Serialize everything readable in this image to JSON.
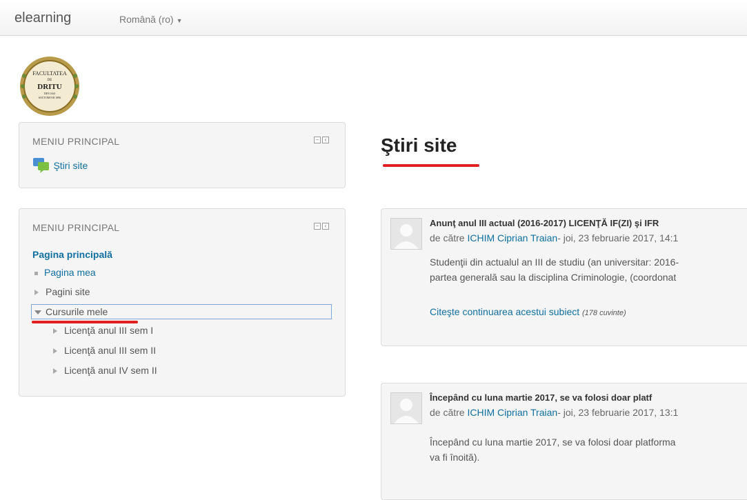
{
  "navbar": {
    "brand": "elearning",
    "language": "Română (ro)"
  },
  "logo": {
    "line1": "FACULTATEA",
    "line2": "DE",
    "line3": "DRITU",
    "line4": "DIN IAȘI",
    "line5": "SOCTOMVIII 1896"
  },
  "block1": {
    "title": "MENIU PRINCIPAL",
    "link": "Ştiri site"
  },
  "block2": {
    "title": "MENIU PRINCIPAL",
    "home": "Pagina principală",
    "items": [
      {
        "label": "Pagina mea"
      },
      {
        "label": "Pagini site"
      },
      {
        "label": "Cursurile mele"
      }
    ],
    "courses": [
      {
        "label": "Licenţă anul III sem I"
      },
      {
        "label": "Licenţă anul III sem II"
      },
      {
        "label": "Licenţă anul IV sem II"
      }
    ]
  },
  "main": {
    "title": "Ştiri site"
  },
  "posts": [
    {
      "subject": "Anunţ anul III actual (2016-2017) LICENŢĂ IF(ZI) şi IFR",
      "by": "de către",
      "author": "ICHIM Ciprian Traian",
      "date": "- joi, 23 februarie 2017, 14:1",
      "line1": "Studenţii din actualul an III de studiu (an universitar: 2016-",
      "line2": "partea generală sau la disciplina Criminologie, (coordonat",
      "more": "Citeşte continuarea acestui subiect",
      "words": "(178 cuvinte)"
    },
    {
      "subject": "Începând cu luna martie 2017, se va folosi doar platf",
      "by": "de către",
      "author": "ICHIM Ciprian Traian",
      "date": "- joi, 23 februarie 2017, 13:1",
      "line1": "Începând cu luna martie 2017, se va folosi doar platforma",
      "line2": "va fi înoită)."
    }
  ]
}
